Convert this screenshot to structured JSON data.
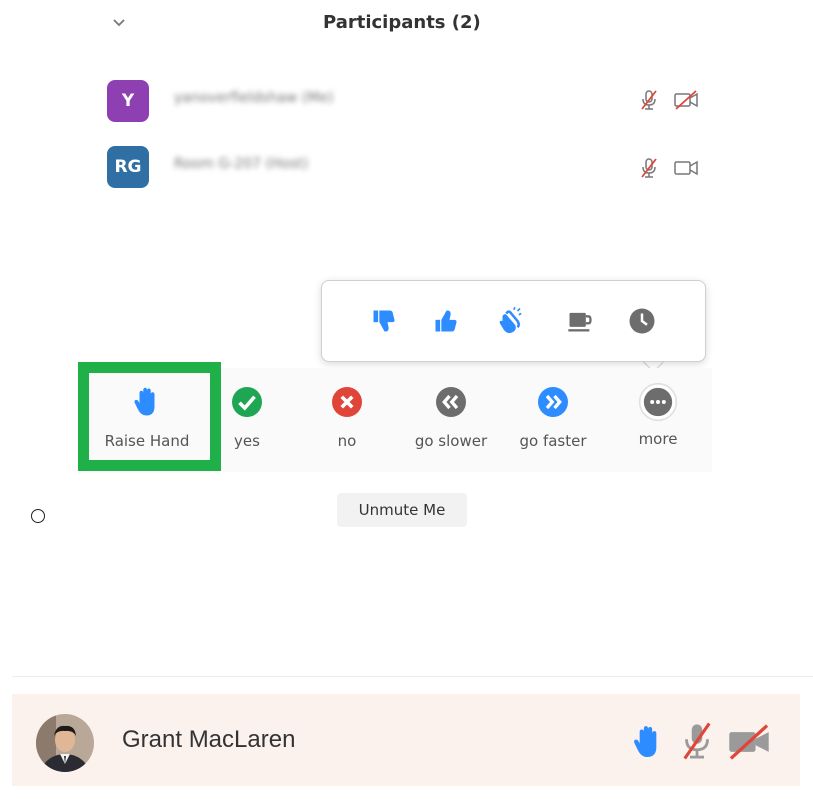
{
  "panel": {
    "title": "Participants (2)",
    "collapse_icon": "chevron-down-icon"
  },
  "participants": [
    {
      "initials": "Y",
      "name": "yanoverfieldshaw (Me)",
      "avatar_color": "#8e3fb2",
      "mic": "muted",
      "video": "off"
    },
    {
      "initials": "RG",
      "name": "Room G-207 (Host)",
      "avatar_color": "#2f6fa3",
      "mic": "muted",
      "video": "on"
    }
  ],
  "reactions": [
    "thumbs-down-icon",
    "thumbs-up-icon",
    "clapping-icon",
    "coffee-icon",
    "clock-icon"
  ],
  "feedback": [
    {
      "label": "Raise Hand",
      "icon": "hand-icon",
      "color": "#2d8cff"
    },
    {
      "label": "yes",
      "icon": "check-icon",
      "color": "#1fa652"
    },
    {
      "label": "no",
      "icon": "x-icon",
      "color": "#e0453a"
    },
    {
      "label": "go slower",
      "icon": "rewind-icon",
      "color": "#6d6d6d"
    },
    {
      "label": "go faster",
      "icon": "fast-forward-icon",
      "color": "#2d8cff"
    },
    {
      "label": "more",
      "icon": "more-icon",
      "color": "#6d6d6d"
    }
  ],
  "unmute_label": "Unmute Me",
  "bottom_row": {
    "name": "Grant MacLaren",
    "status_icons": [
      "hand-icon",
      "mic-muted-icon",
      "video-off-icon"
    ]
  },
  "colors": {
    "highlight": "#1fb04a",
    "zoom_blue": "#2d8cff",
    "muted_red": "#e0453a"
  }
}
